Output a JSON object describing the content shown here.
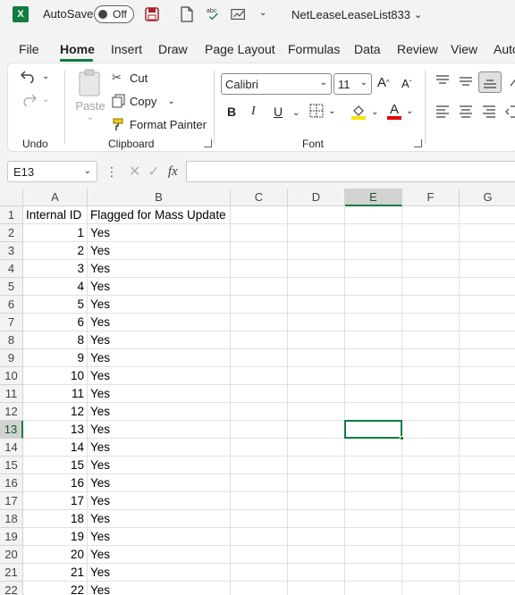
{
  "titlebar": {
    "autosave_label": "AutoSave",
    "toggle_state": "Off",
    "filename": "NetLeaseLeaseList833",
    "brand_color": "#107c41"
  },
  "tabs": [
    "File",
    "Home",
    "Insert",
    "Draw",
    "Page Layout",
    "Formulas",
    "Data",
    "Review",
    "View",
    "Auto"
  ],
  "ribbon": {
    "undo_group": "Undo",
    "clipboard_group": "Clipboard",
    "font_group": "Font",
    "paste": "Paste",
    "cut": "Cut",
    "copy": "Copy",
    "format_painter": "Format Painter",
    "font_name": "Calibri",
    "font_size": "11",
    "bold": "B",
    "italic": "I",
    "underline": "U",
    "font_color_letter": "A",
    "grow_font": "A",
    "shrink_font": "A"
  },
  "formula_bar": {
    "name_box": "E13",
    "fx": "fx",
    "content": ""
  },
  "sheet": {
    "columns": [
      "A",
      "B",
      "C",
      "D",
      "E",
      "F",
      "G"
    ],
    "selected_column": "E",
    "selected_row": "13",
    "rows": [
      {
        "row": "1",
        "a": "Internal ID",
        "b": "Flagged for Mass Update"
      },
      {
        "row": "2",
        "a": "1",
        "b": "Yes"
      },
      {
        "row": "3",
        "a": "2",
        "b": "Yes"
      },
      {
        "row": "4",
        "a": "3",
        "b": "Yes"
      },
      {
        "row": "5",
        "a": "4",
        "b": "Yes"
      },
      {
        "row": "6",
        "a": "5",
        "b": "Yes"
      },
      {
        "row": "7",
        "a": "6",
        "b": "Yes"
      },
      {
        "row": "8",
        "a": "8",
        "b": "Yes"
      },
      {
        "row": "9",
        "a": "9",
        "b": "Yes"
      },
      {
        "row": "10",
        "a": "10",
        "b": "Yes"
      },
      {
        "row": "11",
        "a": "11",
        "b": "Yes"
      },
      {
        "row": "12",
        "a": "12",
        "b": "Yes"
      },
      {
        "row": "13",
        "a": "13",
        "b": "Yes"
      },
      {
        "row": "14",
        "a": "14",
        "b": "Yes"
      },
      {
        "row": "15",
        "a": "15",
        "b": "Yes"
      },
      {
        "row": "16",
        "a": "16",
        "b": "Yes"
      },
      {
        "row": "17",
        "a": "17",
        "b": "Yes"
      },
      {
        "row": "18",
        "a": "18",
        "b": "Yes"
      },
      {
        "row": "19",
        "a": "19",
        "b": "Yes"
      },
      {
        "row": "20",
        "a": "20",
        "b": "Yes"
      },
      {
        "row": "21",
        "a": "21",
        "b": "Yes"
      },
      {
        "row": "22",
        "a": "22",
        "b": "Yes"
      }
    ]
  }
}
